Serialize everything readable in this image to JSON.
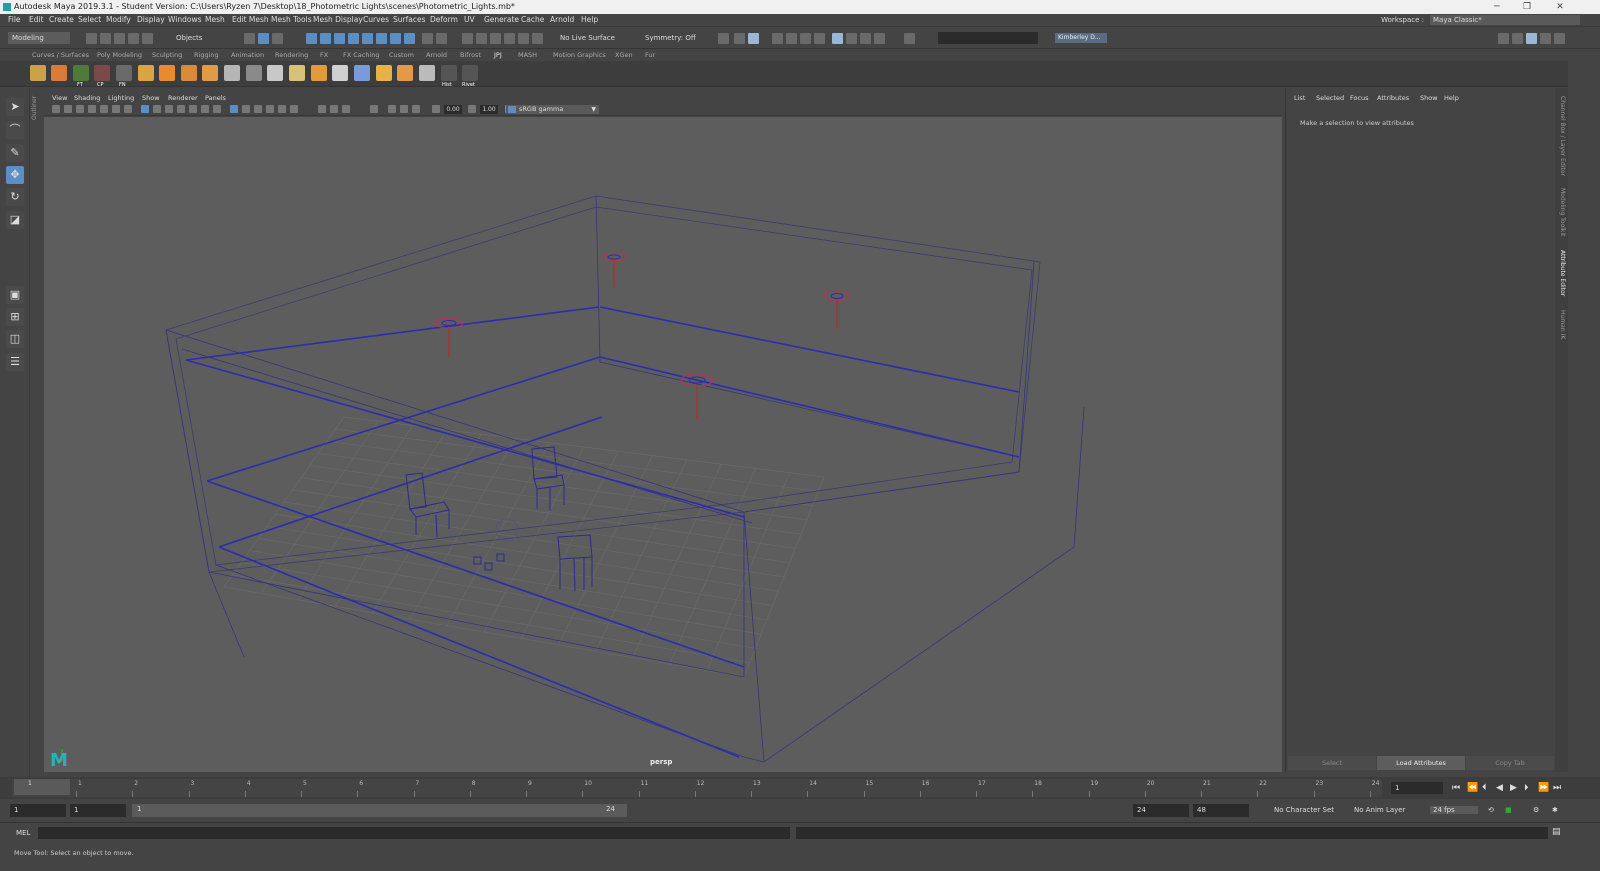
{
  "window": {
    "title": "Autodesk Maya 2019.3.1 - Student Version: C:\\Users\\Ryzen 7\\Desktop\\18_Photometric Lights\\scenes\\Photometric_Lights.mb*",
    "minimize": "─",
    "restore": "❐",
    "close": "✕"
  },
  "menubar": {
    "items": [
      "File",
      "Edit",
      "Create",
      "Select",
      "Modify",
      "Display",
      "Windows",
      "Mesh",
      "Edit Mesh",
      "Mesh Tools",
      "Mesh Display",
      "Curves",
      "Surfaces",
      "Deform",
      "UV",
      "Generate",
      "Cache",
      "Arnold",
      "Help"
    ],
    "workspace_label": "Workspace :",
    "workspace_value": "Maya Classic*"
  },
  "statusline": {
    "menu_set": "Modeling",
    "selection_mode": "Objects",
    "live_surface": "No Live Surface",
    "symmetry": "Symmetry: Off",
    "user": "Kimberley D..."
  },
  "shelf": {
    "tabs": [
      "Curves / Surfaces",
      "Poly Modeling",
      "Sculpting",
      "Rigging",
      "Animation",
      "Rendering",
      "FX",
      "FX Caching",
      "Custom",
      "Arnold",
      "Bifrost",
      "JPJ",
      "MASH",
      "Motion Graphics",
      "XGen",
      "Fur"
    ],
    "active_tab": "JPJ",
    "icon_labels": [
      "FT",
      "CP",
      "FN",
      "Hist",
      "Rivet"
    ],
    "icon_colors": [
      "#c9a24a",
      "#d97b3a",
      "#e6e6e6",
      "#3fb0d0",
      "#d9a441",
      "#e88b2e",
      "#cfcfcf",
      "#8fb0e0",
      "#c8c8c8",
      "#d7c27a",
      "#e39a3a",
      "#d0d0d0",
      "#7a9bd8",
      "#e7b14a",
      "#c0c0c0",
      "#e29a4a",
      "#bbbbbb",
      "#eeeeee",
      "#dddddd"
    ]
  },
  "outliner_tab": "Outliner",
  "viewport": {
    "menu": [
      "View",
      "Shading",
      "Lighting",
      "Show",
      "Renderer",
      "Panels"
    ],
    "exposure": "0.00",
    "gamma": "1.00",
    "color_space": "sRGB gamma",
    "camera": "persp",
    "logo": "M"
  },
  "attribute_editor": {
    "menu": [
      "List",
      "Selected",
      "Focus",
      "Attributes",
      "Show",
      "Help"
    ],
    "message": "Make a selection to view attributes",
    "buttons": [
      "Select",
      "Load Attributes",
      "Copy Tab"
    ]
  },
  "side_tabs": [
    "Channel Box / Layer Editor",
    "Modeling Toolkit",
    "Attribute Editor",
    "Human IK"
  ],
  "active_side_tab": "Attribute Editor",
  "time_slider": {
    "ticks": [
      "1",
      "2",
      "3",
      "4",
      "5",
      "6",
      "7",
      "8",
      "9",
      "10",
      "11",
      "12",
      "13",
      "14",
      "15",
      "16",
      "17",
      "18",
      "19",
      "20",
      "21",
      "22",
      "23",
      "24"
    ],
    "current_frame": "1",
    "current_frame_marker": "1"
  },
  "range_slider": {
    "start": "1",
    "playback_start": "1",
    "bar_start": "1",
    "bar_end": "24",
    "playback_end": "24",
    "end": "48",
    "character_set": "No Character Set",
    "anim_layer": "No Anim Layer",
    "fps": "24 fps"
  },
  "command_line": {
    "label": "MEL"
  },
  "help_line": "Move Tool: Select an object to move."
}
